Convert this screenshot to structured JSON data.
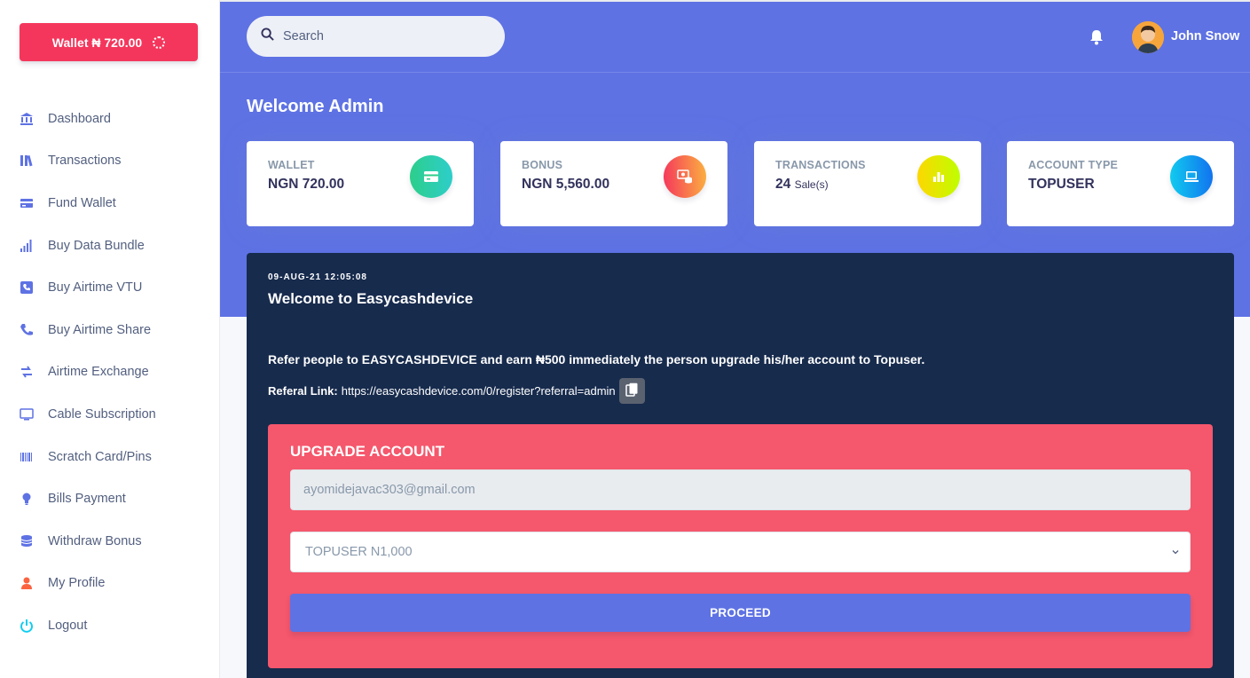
{
  "sidebar": {
    "wallet_button": "Wallet ₦ 720.00",
    "items": [
      {
        "label": "Dashboard",
        "icon": "bank-icon"
      },
      {
        "label": "Transactions",
        "icon": "library-icon"
      },
      {
        "label": "Fund Wallet",
        "icon": "credit-card-icon"
      },
      {
        "label": "Buy Data Bundle",
        "icon": "signal-bars-icon"
      },
      {
        "label": "Buy Airtime VTU",
        "icon": "phone-square-icon"
      },
      {
        "label": "Buy Airtime Share",
        "icon": "phone-icon"
      },
      {
        "label": "Airtime Exchange",
        "icon": "exchange-icon"
      },
      {
        "label": "Cable Subscription",
        "icon": "tv-icon"
      },
      {
        "label": "Scratch Card/Pins",
        "icon": "barcode-icon"
      },
      {
        "label": "Bills Payment",
        "icon": "bulb-icon"
      },
      {
        "label": "Withdraw Bonus",
        "icon": "coins-icon"
      },
      {
        "label": "My Profile",
        "icon": "user-icon"
      },
      {
        "label": "Logout",
        "icon": "power-icon"
      }
    ]
  },
  "header": {
    "search_placeholder": "Search",
    "username": "John Snow",
    "welcome": "Welcome Admin"
  },
  "cards": {
    "wallet": {
      "label": "WALLET",
      "value": "NGN 720.00",
      "color": "#2dce89"
    },
    "bonus": {
      "label": "BONUS",
      "value": "NGN 5,560.00",
      "color": "#fb6340"
    },
    "transactions": {
      "label": "TRANSACTIONS",
      "value": "24",
      "unit": "Sale(s)",
      "color": "#ffd600"
    },
    "account_type": {
      "label": "ACCOUNT TYPE",
      "value": "TOPUSER",
      "color": "#11cdef"
    }
  },
  "panel": {
    "date": "09-AUG-21 12:05:08",
    "title": "Welcome to Easycashdevice",
    "refer_text": "Refer people to EASYCASHDEVICE and earn ₦500 immediately the person upgrade his/her account to Topuser.",
    "referral_label": "Referal Link:",
    "referral_url": "https://easycashdevice.com/0/register?referral=admin"
  },
  "upgrade": {
    "title": "UPGRADE ACCOUNT",
    "email": "ayomidejavac303@gmail.com",
    "selected_plan": "TOPUSER N1,000",
    "proceed_label": "PROCEED"
  },
  "colors": {
    "primary": "#5e72e4",
    "danger": "#f5365c",
    "upgrade_bg": "#f5576c",
    "dark_panel": "#172b4d"
  }
}
